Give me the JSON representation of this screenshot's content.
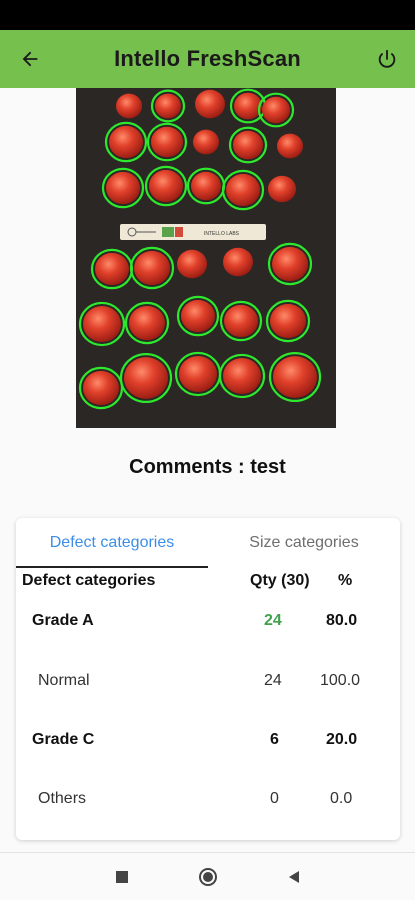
{
  "app": {
    "title": "Intello FreshScan"
  },
  "icons": {
    "back": "arrow-left-icon",
    "power": "power-icon",
    "nav_stop": "square-icon",
    "nav_home": "circle-icon",
    "nav_back": "triangle-back-icon"
  },
  "scan": {
    "ruler_text": "INTELLO LABS"
  },
  "comments": "Comments : test",
  "tabs": [
    {
      "label": "Defect categories",
      "active": true
    },
    {
      "label": "Size categories",
      "active": false
    }
  ],
  "table": {
    "headers": {
      "category": "Defect categories",
      "qty": "Qty (30)",
      "pct": "%"
    },
    "rows": [
      {
        "name": "Grade A",
        "qty": "24",
        "pct": "80.0",
        "style": "grade"
      },
      {
        "name": "Normal",
        "qty": "24",
        "pct": "100.0",
        "style": "sub"
      },
      {
        "name": "Grade C",
        "qty": "6",
        "pct": "20.0",
        "style": "grade"
      },
      {
        "name": "Others",
        "qty": "0",
        "pct": "0.0",
        "style": "sub"
      }
    ]
  },
  "colors": {
    "app_bar": "#76c04e",
    "accent_tab": "#3c8ee6",
    "grade_a_qty": "#3fa24a",
    "detection_ring": "#2ee82e"
  }
}
